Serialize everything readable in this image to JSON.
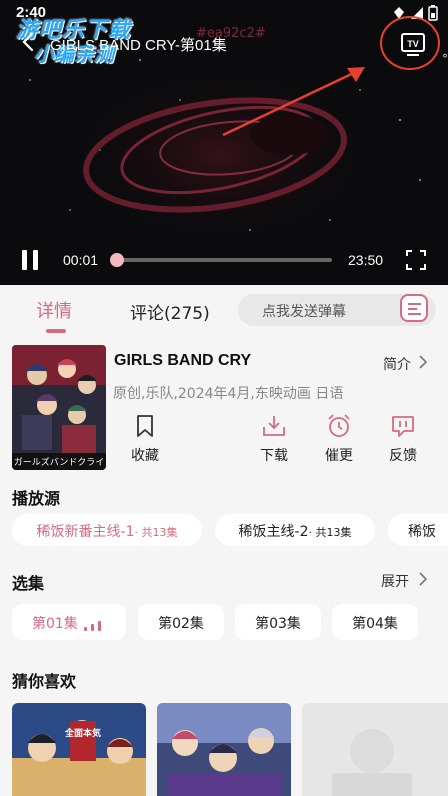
{
  "status_bar": {
    "time": "2:40"
  },
  "watermark": {
    "line1": "游吧乐下载",
    "line2": "小编亲测"
  },
  "player": {
    "title": "GIRLS BAND CRY-第01集",
    "danmaku_tag": "#ea92c2#",
    "current_time": "00:01",
    "total_time": "23:50",
    "progress": 0.01
  },
  "tabs": {
    "detail": "详情",
    "comments": "评论(275)"
  },
  "danmaku_input": {
    "placeholder": "点我发送弹幕"
  },
  "anime": {
    "title": "GIRLS BAND CRY",
    "intro_label": "简介",
    "tags": "原创,乐队,2024年4月,东映动画 日语",
    "poster_caption": "ガールズバンドクライ"
  },
  "actions": {
    "favorite": "收藏",
    "download": "下载",
    "remind": "催更",
    "feedback": "反馈"
  },
  "sources": {
    "title": "播放源",
    "items": [
      {
        "label": "稀饭新番主线-1",
        "count": "· 共13集"
      },
      {
        "label": "稀饭主线-2",
        "count": "· 共13集"
      },
      {
        "label": "稀饭"
      }
    ]
  },
  "episodes": {
    "title": "选集",
    "expand_label": "展开",
    "items": [
      "第01集",
      "第02集",
      "第03集",
      "第04集"
    ]
  },
  "recommend": {
    "title": "猜你喜欢",
    "card1_caption": "全面本気"
  },
  "colors": {
    "accent": "#d86a80",
    "annotation_red": "#e8402f"
  }
}
